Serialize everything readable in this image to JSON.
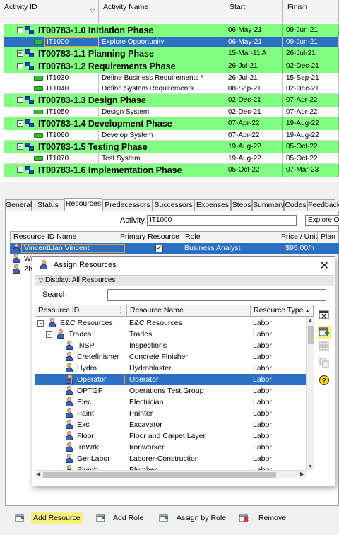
{
  "grid": {
    "headers": {
      "activity_id": "Activity ID",
      "activity_name": "Activity Name",
      "start": "Start",
      "finish": "Finish"
    },
    "rows": [
      {
        "kind": "wbs",
        "label": "IT00783-1.0  Initiation Phase",
        "start": "06-May-21",
        "finish": "09-Jun-21",
        "expand": "-"
      },
      {
        "kind": "sel",
        "id": "IT1000",
        "name": "Explore Opportunity",
        "start": "06-May-21",
        "finish": "09-Jun-21"
      },
      {
        "kind": "wbs",
        "label": "IT00783-1.1  Planning Phase",
        "start": "15-Mar-11 A",
        "finish": "26-Jul-21",
        "expand": "+"
      },
      {
        "kind": "wbs",
        "label": "IT00783-1.2  Requirements Phase",
        "start": "26-Jul-21",
        "finish": "02-Dec-21",
        "expand": "-"
      },
      {
        "kind": "act",
        "id": "IT1030",
        "name": "Define Business Requirements *",
        "start": "26-Jul-21",
        "finish": "15-Sep-21"
      },
      {
        "kind": "act",
        "id": "IT1040",
        "name": "Define System Requirements",
        "start": "08-Sep-21",
        "finish": "02-Dec-21"
      },
      {
        "kind": "wbs",
        "label": "IT00783-1.3  Design Phase",
        "start": "02-Dec-21",
        "finish": "07-Apr-22",
        "expand": "-"
      },
      {
        "kind": "act",
        "id": "IT1050",
        "name": "Design System",
        "start": "02-Dec-21",
        "finish": "07-Apr-22"
      },
      {
        "kind": "wbs",
        "label": "IT00783-1.4  Development Phase",
        "start": "07-Apr-22",
        "finish": "19-Aug-22",
        "expand": "-"
      },
      {
        "kind": "act",
        "id": "IT1060",
        "name": "Develop System",
        "start": "07-Apr-22",
        "finish": "19-Aug-22"
      },
      {
        "kind": "wbs",
        "label": "IT00783-1.5  Testing Phase",
        "start": "19-Aug-22",
        "finish": "05-Oct-22",
        "expand": "-"
      },
      {
        "kind": "act",
        "id": "IT1070",
        "name": "Test System",
        "start": "19-Aug-22",
        "finish": "05-Oct-22"
      },
      {
        "kind": "wbs",
        "label": "IT00783-1.6  Implementation Phase",
        "start": "05-Oct-22",
        "finish": "07-Mar-23",
        "expand": "-"
      }
    ]
  },
  "details": {
    "tabs": [
      "General",
      "Status",
      "Resources",
      "Predecessors",
      "Successors",
      "Expenses",
      "Steps",
      "Summary",
      "Codes",
      "Feedback"
    ],
    "active_tab": "Resources",
    "activity_label": "Activity",
    "activity_id": "IT1000",
    "activity_name": "Explore Op",
    "resource_headers": {
      "resource_id_name": "Resource ID Name",
      "primary": "Primary Resource",
      "role": "Role",
      "price": "Price / Unit",
      "plan": "Plan"
    },
    "resources": [
      {
        "name": "VincentLlan Vincent",
        "primary": true,
        "role": "Business Analyst",
        "price": "$95.00/h"
      },
      {
        "name": "Wi",
        "primary": false,
        "role": "",
        "price": ""
      },
      {
        "name": "Zh",
        "primary": false,
        "role": "",
        "price": ""
      }
    ]
  },
  "toolbar": {
    "add_resource": "Add Resource",
    "add_role": "Add Role",
    "assign_by_role": "Assign by Role",
    "remove": "Remove"
  },
  "dialog": {
    "title": "Assign Resources",
    "display": "Display: All Resources",
    "search_label": "Search",
    "search_value": "",
    "headers": {
      "resource_id": "Resource ID",
      "resource_name": "Resource Name",
      "resource_type": "Resource Type"
    },
    "rows": [
      {
        "id": "E&C Resources",
        "name": "E&C Resources",
        "type": "Labor",
        "level": 0,
        "expand": "-"
      },
      {
        "id": "Trades",
        "name": "Trades",
        "type": "Labor",
        "level": 1,
        "expand": "-"
      },
      {
        "id": "INSP",
        "name": "Inspections",
        "type": "Labor",
        "level": 2
      },
      {
        "id": "Cretefinisher",
        "name": "Concrete Finisher",
        "type": "Labor",
        "level": 2
      },
      {
        "id": "Hydro",
        "name": "Hydroblaster",
        "type": "Labor",
        "level": 2
      },
      {
        "id": "Operator",
        "name": "Operator",
        "type": "Labor",
        "level": 2,
        "selected": true
      },
      {
        "id": "OPTGP",
        "name": "Operations Test Group",
        "type": "Labor",
        "level": 2
      },
      {
        "id": "Elec",
        "name": "Electrician",
        "type": "Labor",
        "level": 2
      },
      {
        "id": "Paint",
        "name": "Painter",
        "type": "Labor",
        "level": 2
      },
      {
        "id": "Exc",
        "name": "Excavator",
        "type": "Labor",
        "level": 2
      },
      {
        "id": "Floor",
        "name": "Floor and Carpet Layer",
        "type": "Labor",
        "level": 2
      },
      {
        "id": "IrnWrk",
        "name": "Ironworker",
        "type": "Labor",
        "level": 2
      },
      {
        "id": "GenLabor",
        "name": "Laborer-Construction",
        "type": "Labor",
        "level": 2
      },
      {
        "id": "Plumb",
        "name": "Plumber",
        "type": "Labor",
        "level": 2
      }
    ]
  },
  "colors": {
    "wbs_band": "#80ff80",
    "selection": "#2b70c5",
    "highlight": "#f8f080",
    "outline": "#f39c2d"
  }
}
